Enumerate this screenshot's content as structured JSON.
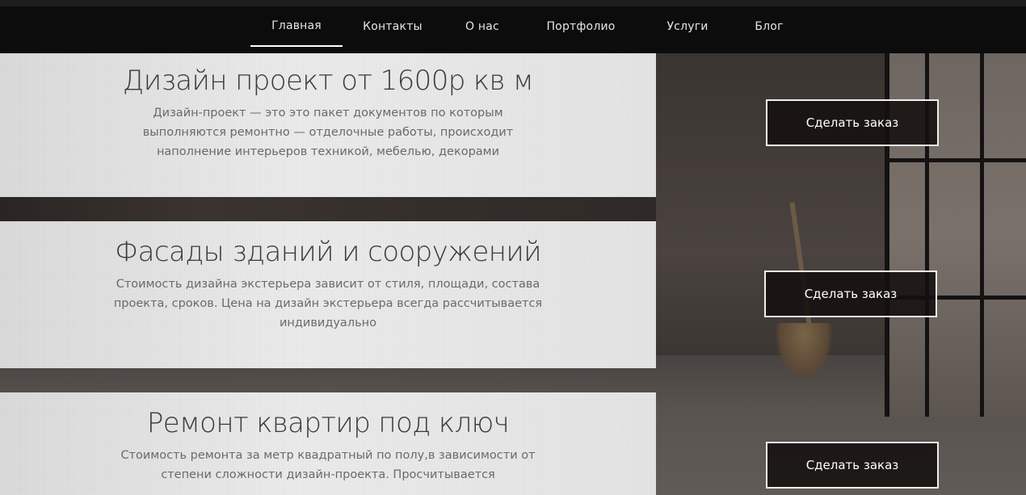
{
  "nav": {
    "items": [
      {
        "label": "Главная",
        "active": true
      },
      {
        "label": "Контакты",
        "active": false
      },
      {
        "label": "О нас",
        "active": false
      },
      {
        "label": "Портфолио",
        "active": false
      },
      {
        "label": "Услуги",
        "active": false
      },
      {
        "label": "Блог",
        "active": false
      }
    ]
  },
  "services": [
    {
      "title": "Дизайн проект от 1600р кв м",
      "description": "Дизайн-проект — это это пакет документов по которым выполняются ремонтно — отделочные работы, происходит наполнение интерьеров техникой, мебелью, декорами",
      "button": "Сделать заказ"
    },
    {
      "title": "Фасады зданий и сооружений",
      "description": "Стоимость дизайна экстерьера зависит от стиля, площади, состава проекта, сроков. Цена на дизайн экстерьера всегда рассчитывается индивидуально",
      "button": "Сделать заказ"
    },
    {
      "title": "Ремонт квартир под ключ",
      "description": "Стоимость ремонта за метр квадратный по полу,в зависимости от степени сложности дизайн-проекта. Просчитывается",
      "button": "Сделать заказ"
    }
  ],
  "colors": {
    "nav_background": "#0d0c0c",
    "card_background": "#e6e6e6",
    "button_background": "#14100f",
    "button_border": "#f0f0f0"
  }
}
